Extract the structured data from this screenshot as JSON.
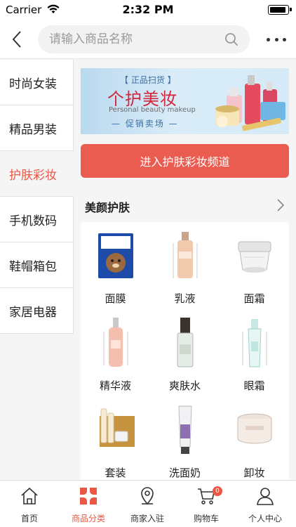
{
  "status_bar": {
    "carrier": "Carrier",
    "time": "2:32 PM"
  },
  "header": {
    "search_placeholder": "请输入商品名称",
    "search_value": ""
  },
  "sidebar": {
    "items": [
      {
        "label": "时尚女装"
      },
      {
        "label": "精品男装"
      },
      {
        "label": "护肤彩妆"
      },
      {
        "label": "手机数码"
      },
      {
        "label": "鞋帽箱包"
      },
      {
        "label": "家居电器"
      }
    ],
    "active_index": 2
  },
  "banner": {
    "tag": "【 正品扫货 】",
    "title": "个护美妆",
    "subtitle": "Personal beauty makeup",
    "promo": "— 促销卖场 —"
  },
  "cta": {
    "label": "进入护肤彩妆频道"
  },
  "section": {
    "title": "美颜护肤"
  },
  "products": [
    {
      "label": "面膜",
      "icon": "face-mask-icon"
    },
    {
      "label": "乳液",
      "icon": "lotion-bottle-icon"
    },
    {
      "label": "面霜",
      "icon": "cream-jar-icon"
    },
    {
      "label": "精华液",
      "icon": "serum-bottle-icon"
    },
    {
      "label": "爽肤水",
      "icon": "toner-bottle-icon"
    },
    {
      "label": "眼霜",
      "icon": "eye-cream-tube-icon"
    },
    {
      "label": "套装",
      "icon": "gift-set-icon"
    },
    {
      "label": "洗面奶",
      "icon": "cleanser-tube-icon"
    },
    {
      "label": "卸妆",
      "icon": "makeup-remover-jar-icon"
    }
  ],
  "tabbar": {
    "tabs": [
      {
        "label": "首页",
        "icon": "home-icon"
      },
      {
        "label": "商品分类",
        "icon": "category-icon"
      },
      {
        "label": "商家入驻",
        "icon": "location-pin-icon"
      },
      {
        "label": "购物车",
        "icon": "cart-icon"
      },
      {
        "label": "个人中心",
        "icon": "user-icon"
      }
    ],
    "active_index": 1,
    "cart_badge": "0"
  },
  "colors": {
    "accent": "#ea5744",
    "cta": "#ea5c4f",
    "background": "#f5f5f5"
  }
}
